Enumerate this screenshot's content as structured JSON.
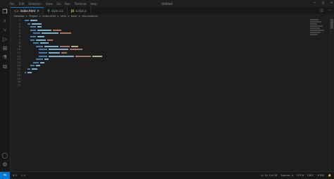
{
  "window": {
    "title": "Untitled",
    "menu": [
      "File",
      "Edit",
      "Selection",
      "View",
      "Go",
      "Run",
      "Terminal",
      "Help"
    ],
    "controls": [
      "minimize",
      "maximize",
      "close"
    ]
  },
  "activity_bar": {
    "icons": [
      "files-icon",
      "search-icon",
      "source-control-icon",
      "run-debug-icon",
      "extensions-icon",
      "testing-icon",
      "remote-explorer-icon"
    ],
    "bottom_icons": [
      "account-icon",
      "settings-gear-icon"
    ]
  },
  "tabs": [
    {
      "label": "index.html",
      "icon": "<>",
      "active": true
    },
    {
      "label": "style.css",
      "icon": "#",
      "active": false
    },
    {
      "label": "script.js",
      "icon": "JS",
      "active": false
    }
  ],
  "breadcrumb": [
    "Desktop",
    ">",
    "Project",
    ">",
    "index.html",
    ">",
    "html",
    ">",
    "body",
    ">",
    "div.container"
  ],
  "editor": {
    "line_numbers": [
      "1",
      "2",
      "3",
      "4",
      "5",
      "6",
      "7",
      "8",
      "9",
      "10",
      "11",
      "12",
      "13",
      "14",
      "15",
      "16",
      "17",
      "18",
      "19",
      "20",
      "21"
    ]
  },
  "status": {
    "left": [
      "⊗ 0",
      "⚠ 0"
    ],
    "right": [
      "Ln 14, Col 28",
      "Spaces: 4",
      "UTF-8",
      "CRLF",
      "HTML",
      "🔔"
    ]
  },
  "colors": {
    "accent": "#0078d4",
    "background": "#1e1e1e",
    "tag": "#569cd6",
    "attribute": "#9cdcfe",
    "string": "#ce9178"
  }
}
